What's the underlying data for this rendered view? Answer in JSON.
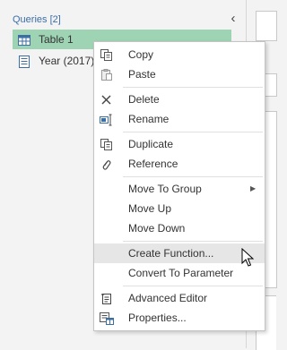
{
  "queries": {
    "header": "Queries [2]",
    "collapse_glyph": "‹",
    "items": [
      {
        "label": "Table 1",
        "icon": "table-icon",
        "selected": true
      },
      {
        "label": "Year (2017)",
        "icon": "parameter-list-icon",
        "selected": false
      }
    ]
  },
  "menu": {
    "items": [
      {
        "label": "Copy",
        "icon": "copy-icon"
      },
      {
        "label": "Paste",
        "icon": "paste-icon"
      },
      {
        "label": "Delete",
        "icon": "delete-icon"
      },
      {
        "label": "Rename",
        "icon": "rename-icon"
      },
      {
        "label": "Duplicate",
        "icon": "duplicate-icon"
      },
      {
        "label": "Reference",
        "icon": "reference-icon"
      },
      {
        "label": "Move To Group",
        "icon": "",
        "submenu_glyph": "▶"
      },
      {
        "label": "Move Up",
        "icon": ""
      },
      {
        "label": "Move Down",
        "icon": ""
      },
      {
        "label": "Create Function...",
        "icon": "",
        "hovered": true
      },
      {
        "label": "Convert To Parameter",
        "icon": ""
      },
      {
        "label": "Advanced Editor",
        "icon": "advanced-editor-icon"
      },
      {
        "label": "Properties...",
        "icon": "properties-icon"
      }
    ]
  },
  "colors": {
    "selection": "#9ed3b3",
    "header_text": "#3b6ea8",
    "hover": "#e6e6e6"
  }
}
